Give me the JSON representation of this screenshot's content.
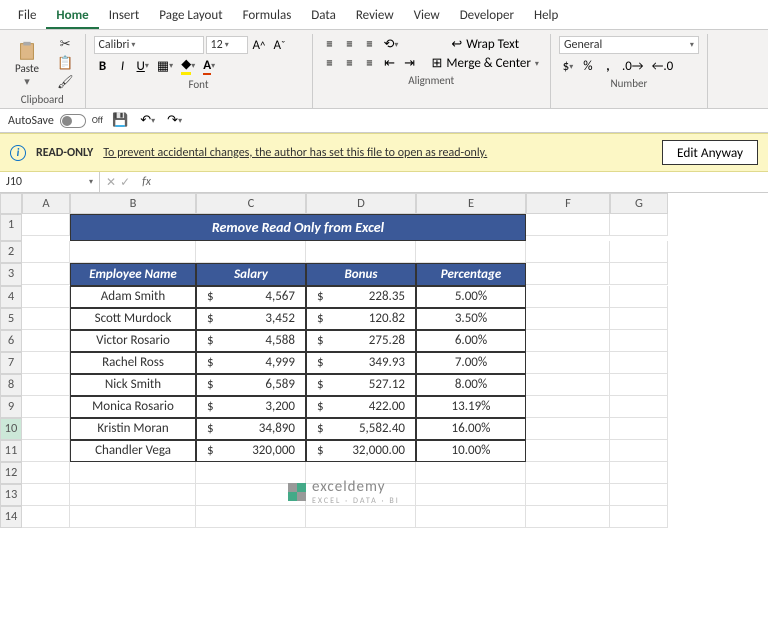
{
  "menu": [
    "File",
    "Home",
    "Insert",
    "Page Layout",
    "Formulas",
    "Data",
    "Review",
    "View",
    "Developer",
    "Help"
  ],
  "active_tab": "Home",
  "ribbon": {
    "clipboard_label": "Clipboard",
    "paste_label": "Paste",
    "font_label": "Font",
    "font_name": "Calibri",
    "font_size": "12",
    "alignment_label": "Alignment",
    "wrap_label": "Wrap Text",
    "merge_label": "Merge & Center",
    "number_label": "Number",
    "number_format": "General"
  },
  "qat": {
    "autosave": "AutoSave",
    "autosave_state": "Off"
  },
  "msgbar": {
    "title": "READ-ONLY",
    "text": "To prevent accidental changes, the author has set this file to open as read-only.",
    "btn": "Edit Anyway"
  },
  "fbar": {
    "namebox": "J10",
    "formula": ""
  },
  "columns": [
    "A",
    "B",
    "C",
    "D",
    "E",
    "F",
    "G"
  ],
  "sheet_title": "Remove Read Only from Excel",
  "headers": [
    "Employee Name",
    "Salary",
    "Bonus",
    "Percentage"
  ],
  "rows": [
    {
      "name": "Adam Smith",
      "salary": "4,567",
      "bonus": "228.35",
      "pct": "5.00%"
    },
    {
      "name": "Scott Murdock",
      "salary": "3,452",
      "bonus": "120.82",
      "pct": "3.50%"
    },
    {
      "name": "Victor Rosario",
      "salary": "4,588",
      "bonus": "275.28",
      "pct": "6.00%"
    },
    {
      "name": "Rachel Ross",
      "salary": "4,999",
      "bonus": "349.93",
      "pct": "7.00%"
    },
    {
      "name": "Nick Smith",
      "salary": "6,589",
      "bonus": "527.12",
      "pct": "8.00%"
    },
    {
      "name": "Monica Rosario",
      "salary": "3,200",
      "bonus": "422.00",
      "pct": "13.19%"
    },
    {
      "name": "Kristin Moran",
      "salary": "34,890",
      "bonus": "5,582.40",
      "pct": "16.00%"
    },
    {
      "name": "Chandler Vega",
      "salary": "320,000",
      "bonus": "32,000.00",
      "pct": "10.00%"
    }
  ],
  "logo": {
    "name": "exceldemy",
    "tag": "EXCEL · DATA · BI"
  }
}
